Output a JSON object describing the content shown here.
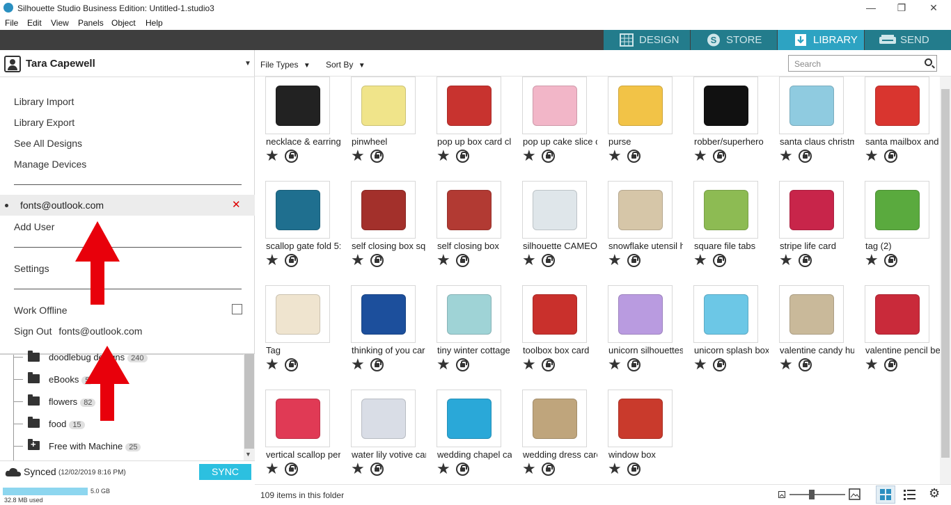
{
  "window": {
    "title": "Silhouette Studio Business Edition: Untitled-1.studio3",
    "minimize": "—",
    "restore": "❐",
    "close": "✕"
  },
  "menu": [
    "File",
    "Edit",
    "View",
    "Panels",
    "Object",
    "Help"
  ],
  "modes": [
    {
      "label": "DESIGN",
      "icon": "grid-icon"
    },
    {
      "label": "STORE",
      "icon": "silhouette-s-icon"
    },
    {
      "label": "LIBRARY",
      "icon": "download-icon",
      "active": true
    },
    {
      "label": "SEND",
      "icon": "cutter-icon"
    }
  ],
  "user": {
    "name": "Tara Capewell",
    "menu": [
      "Library Import",
      "Library Export",
      "See All Designs",
      "Manage Devices"
    ],
    "account_email": "fonts@outlook.com",
    "add_user": "Add User",
    "settings": "Settings",
    "work_offline": "Work Offline",
    "sign_out": "Sign Out",
    "sign_out_email": "fonts@outlook.com"
  },
  "folders": [
    {
      "name": "doodlebug designs",
      "count": "240"
    },
    {
      "name": "eBooks",
      "count": "5"
    },
    {
      "name": "flowers",
      "count": "82"
    },
    {
      "name": "food",
      "count": "15"
    },
    {
      "name": "Free with Machine",
      "count": "25"
    }
  ],
  "status": {
    "synced": "Synced",
    "synced_time": "(12/02/2019 8:16 PM)",
    "sync_button": "SYNC",
    "capacity": "5.0 GB",
    "used": "32.8 MB used",
    "used_fraction": 0.0064
  },
  "toolbar": {
    "file_types": "File Types",
    "sort_by": "Sort By",
    "search_placeholder": "Search"
  },
  "items": [
    {
      "name": "necklace & earring",
      "color": "#222222"
    },
    {
      "name": "pinwheel",
      "color": "#f0e48a"
    },
    {
      "name": "pop up box card cl",
      "color": "#c8332f"
    },
    {
      "name": "pop up cake slice c",
      "color": "#f2b6c8"
    },
    {
      "name": "purse",
      "color": "#f2c347"
    },
    {
      "name": "robber/superhero ",
      "color": "#111111"
    },
    {
      "name": "santa claus christm",
      "color": "#8fcbe0"
    },
    {
      "name": "santa mailbox and",
      "color": "#d9352f"
    },
    {
      "name": "scallop gate fold 5:",
      "color": "#1f6f8f"
    },
    {
      "name": "self closing box squ",
      "color": "#a3302b"
    },
    {
      "name": "self closing box",
      "color": "#b23a33"
    },
    {
      "name": "silhouette CAMEO.",
      "color": "#dfe6ea"
    },
    {
      "name": "snowflake utensil h",
      "color": "#d6c6a8"
    },
    {
      "name": "square file tabs",
      "color": "#8dbb53"
    },
    {
      "name": "stripe life card",
      "color": "#c8254a"
    },
    {
      "name": "tag (2)",
      "color": "#5aaa3e"
    },
    {
      "name": "Tag",
      "color": "#efe4cf"
    },
    {
      "name": "thinking of you car",
      "color": "#1c4f9c"
    },
    {
      "name": "tiny winter cottage",
      "color": "#9fd3d6"
    },
    {
      "name": "toolbox box card",
      "color": "#c9302c"
    },
    {
      "name": "unicorn silhouettes",
      "color": "#b99be0"
    },
    {
      "name": "unicorn splash box",
      "color": "#6cc7e6"
    },
    {
      "name": "valentine candy hu",
      "color": "#c9b99a"
    },
    {
      "name": "valentine pencil be",
      "color": "#c92a3a"
    },
    {
      "name": "vertical scallop per",
      "color": "#e03a55"
    },
    {
      "name": "water lily votive car",
      "color": "#d9dde6"
    },
    {
      "name": "wedding chapel ca",
      "color": "#2aa8d8"
    },
    {
      "name": "wedding dress carc",
      "color": "#bfa57c"
    },
    {
      "name": "window box",
      "color": "#c93a2c"
    }
  ],
  "footer": {
    "item_count": "109 items in this folder"
  }
}
